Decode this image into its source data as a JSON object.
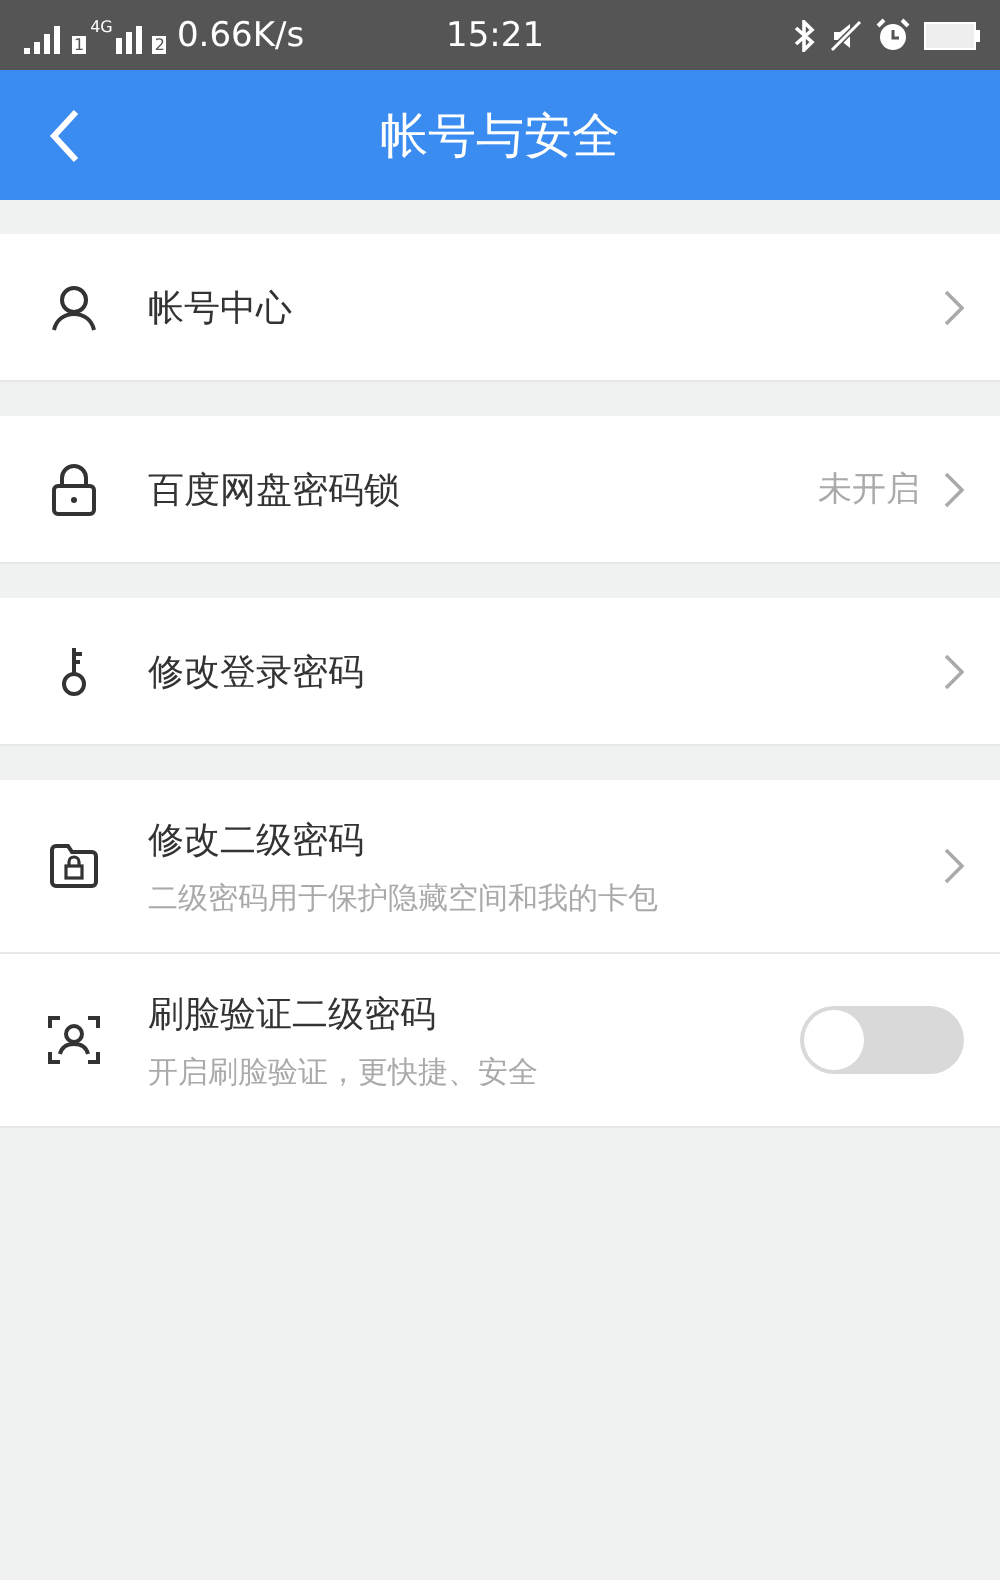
{
  "status_bar": {
    "network": "4G",
    "sim_1": "1",
    "sim_2": "2",
    "speed": "0.66K/s",
    "time": "15:21"
  },
  "nav": {
    "title": "帐号与安全"
  },
  "groups": [
    {
      "items": [
        {
          "kind": "link",
          "label": "帐号中心"
        }
      ]
    },
    {
      "items": [
        {
          "kind": "link",
          "label": "百度网盘密码锁",
          "value": "未开启"
        }
      ]
    },
    {
      "items": [
        {
          "kind": "link",
          "label": "修改登录密码"
        }
      ]
    },
    {
      "items": [
        {
          "kind": "link",
          "label": "修改二级密码",
          "description": "二级密码用于保护隐藏空间和我的卡包"
        },
        {
          "kind": "toggle",
          "label": "刷脸验证二级密码",
          "description": "开启刷脸验证，更快捷、安全",
          "on": false
        }
      ]
    }
  ]
}
